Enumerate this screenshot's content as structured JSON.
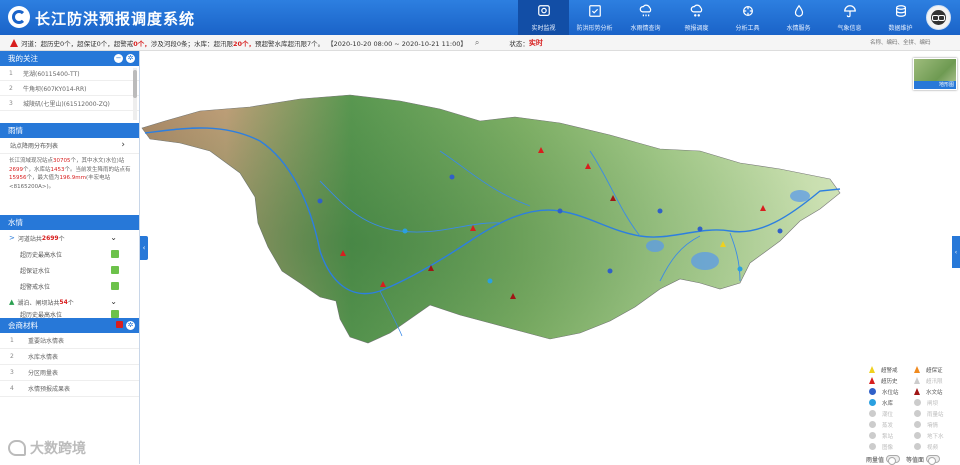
{
  "header": {
    "title": "长江防洪预报调度系统",
    "nav": [
      {
        "label": "实时监视",
        "icon": "monitor-icon",
        "active": true
      },
      {
        "label": "防洪形势分析",
        "icon": "checklist-icon",
        "active": false
      },
      {
        "label": "水雨情查询",
        "icon": "rain-cloud-icon",
        "active": false
      },
      {
        "label": "预报调度",
        "icon": "snow-cloud-icon",
        "active": false
      },
      {
        "label": "分析工具",
        "icon": "tools-icon",
        "active": false
      },
      {
        "label": "水情服务",
        "icon": "water-drop-icon",
        "active": false
      },
      {
        "label": "气象信息",
        "icon": "umbrella-icon",
        "active": false
      },
      {
        "label": "数据维护",
        "icon": "database-icon",
        "active": false
      }
    ]
  },
  "warning_bar": {
    "river_label": "河道：",
    "over_history_label": "超历史",
    "over_history_count": "0个，",
    "over_guarantee_label": "超保证",
    "over_guarantee_count": "0个，",
    "over_warning_label": "超警戒",
    "over_warning_count": "0个，",
    "floodway_text": "涉及河段0条；",
    "reservoir_label": "水库：",
    "over_limit_label": "超汛限",
    "over_limit_count": "20个，",
    "over_design_text": "预超警水库超汛限7个。",
    "time_range": "【2020-10-20 08:00 ~ 2020-10-21 11:00】",
    "status_label": "状态：",
    "status_value": "实时",
    "search_placeholder": "名称、编码、全拼、编码"
  },
  "panel": {
    "attention": {
      "title": "我的关注",
      "items": [
        {
          "num": "1",
          "text": "芜湖(60115400-TT)"
        },
        {
          "num": "2",
          "text": "牛角坝(607KY014-RR)"
        },
        {
          "num": "3",
          "text": "城陵矶(七里山)(61512000-ZQ)"
        }
      ]
    },
    "rain": {
      "title": "雨情",
      "link": "站点降雨分布列表",
      "desc_parts": [
        {
          "t": "长江流域现况站点",
          "red": false
        },
        {
          "t": "30705",
          "red": true
        },
        {
          "t": "个，其中水文(水位)站",
          "red": false
        },
        {
          "t": "2699",
          "red": true
        },
        {
          "t": "个，水库站",
          "red": false
        },
        {
          "t": "1453",
          "red": true
        },
        {
          "t": "个。当前发生降雨的站点有",
          "red": false
        },
        {
          "t": "15956",
          "red": true
        },
        {
          "t": "个，最大值为",
          "red": false
        },
        {
          "t": "196.9mm",
          "red": true
        },
        {
          "t": "(丰宏电站<8165200A>)。",
          "red": false
        }
      ]
    },
    "water": {
      "title": "水情",
      "river_row_prefix": "河道站共",
      "river_row_count": "2699",
      "river_row_suffix": "个",
      "sub_items": [
        "超历史最高水位",
        "超保证水位",
        "超警戒水位"
      ],
      "reservoir_row_prefix": "湖泊、闸坝站共",
      "reservoir_row_count": "54",
      "reservoir_row_suffix": "个",
      "reservoir_sub": "超历史最高水位"
    },
    "materials": {
      "title": "会商材料",
      "items": [
        {
          "num": "1",
          "text": "重要站水情表"
        },
        {
          "num": "2",
          "text": "水库水情表"
        },
        {
          "num": "3",
          "text": "分区雨量表"
        },
        {
          "num": "4",
          "text": "水情预报成果表"
        }
      ]
    }
  },
  "minimap": {
    "label": "地形图"
  },
  "legend": {
    "rows": [
      [
        {
          "label": "超警戒",
          "shape": "tri",
          "color": "#f0d11e",
          "dim": false
        },
        {
          "label": "超保证",
          "shape": "tri",
          "color": "#f08a1e",
          "dim": false
        }
      ],
      [
        {
          "label": "超历史",
          "shape": "tri",
          "color": "#d81e1e",
          "dim": false
        },
        {
          "label": "超汛限",
          "shape": "tri",
          "color": "#cccccc",
          "dim": true
        }
      ],
      [
        {
          "label": "水位站",
          "shape": "dot",
          "color": "#3060c8",
          "dim": false
        },
        {
          "label": "水文站",
          "shape": "tri",
          "color": "#a01515",
          "dim": false
        }
      ],
      [
        {
          "label": "水库",
          "shape": "dot",
          "color": "#2aa0e0",
          "dim": false
        },
        {
          "label": "闸坝",
          "shape": "dot",
          "color": "#cccccc",
          "dim": true
        }
      ],
      [
        {
          "label": "潮位",
          "shape": "dot",
          "color": "#cccccc",
          "dim": true
        },
        {
          "label": "雨量站",
          "shape": "dot",
          "color": "#cccccc",
          "dim": true
        }
      ],
      [
        {
          "label": "蒸发",
          "shape": "dot",
          "color": "#cccccc",
          "dim": true
        },
        {
          "label": "墒情",
          "shape": "dot",
          "color": "#cccccc",
          "dim": true
        }
      ],
      [
        {
          "label": "泵站",
          "shape": "dot",
          "color": "#cccccc",
          "dim": true
        },
        {
          "label": "地下水",
          "shape": "dot",
          "color": "#cccccc",
          "dim": true
        }
      ],
      [
        {
          "label": "图像",
          "shape": "dot",
          "color": "#cccccc",
          "dim": true
        },
        {
          "label": "视频",
          "shape": "dot",
          "color": "#cccccc",
          "dim": true
        }
      ]
    ],
    "toggle_1": "雨量值",
    "toggle_2": "等值面"
  },
  "watermark": "大数跨境"
}
